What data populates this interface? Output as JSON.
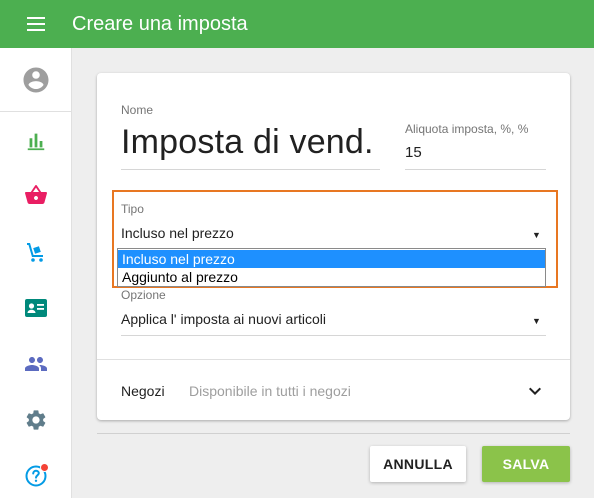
{
  "appbar": {
    "title": "Creare una imposta"
  },
  "sidebar": {
    "items": [
      {
        "icon": "account-circle-icon"
      },
      {
        "icon": "bar-chart-icon"
      },
      {
        "icon": "shopping-basket-icon"
      },
      {
        "icon": "inventory-cart-icon"
      },
      {
        "icon": "contact-card-icon"
      },
      {
        "icon": "people-icon"
      },
      {
        "icon": "gear-icon"
      },
      {
        "icon": "help-icon"
      }
    ]
  },
  "form": {
    "name_label": "Nome",
    "name_value": "Imposta di vend.",
    "rate_label": "Aliquota imposta, %, %",
    "rate_value": "15",
    "type_label": "Tipo",
    "type_value": "Incluso nel prezzo",
    "type_options": [
      "Incluso nel prezzo",
      "Aggiunto al prezzo"
    ],
    "option_label": "Opzione",
    "option_value": "Applica l' imposta ai nuovi articoli",
    "stores_label": "Negozi",
    "stores_value": "Disponibile in tutti i negozi"
  },
  "actions": {
    "cancel_label": "ANNULLA",
    "save_label": "SALVA"
  },
  "colors": {
    "appbar": "#4caf50",
    "save_button": "#8bc34a",
    "highlight_border": "#e87722",
    "selected_option": "#1e90ff",
    "notification_dot": "#f44336"
  }
}
